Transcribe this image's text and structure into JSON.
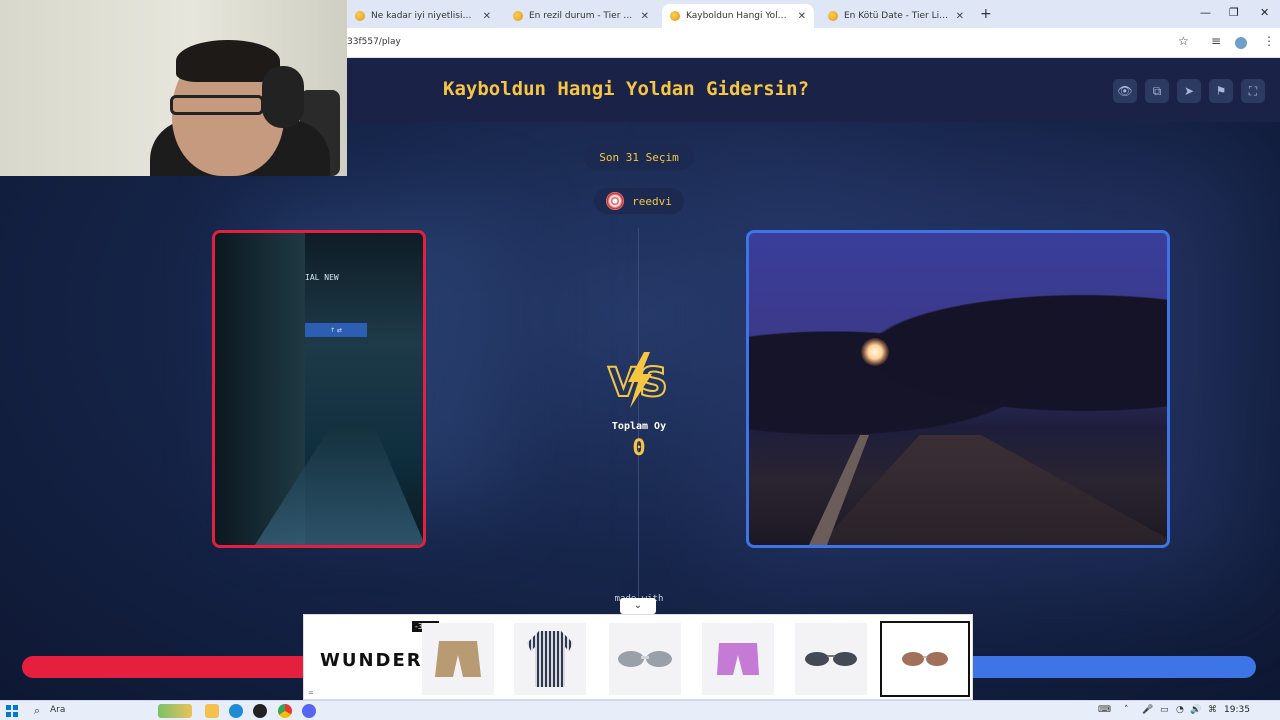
{
  "browser": {
    "tabs": [
      {
        "title": "Ne kadar iyi niyetlisin? - Tier Li…",
        "active": false
      },
      {
        "title": "En rezil durum - Tier List | Kör S…",
        "active": false
      },
      {
        "title": "Kayboldun Hangi Yoldan Gider…",
        "active": true
      },
      {
        "title": "En Kötü Date - Tier List | Kör S…",
        "active": false
      }
    ],
    "new_tab": "+",
    "url": "33f557/play",
    "window_controls": {
      "minimize": "—",
      "restore": "❐",
      "close": "✕"
    }
  },
  "game": {
    "title": "Kayboldun Hangi Yoldan Gidersin?",
    "recent_picks": "Son 31 Seçim",
    "user": "reedvi",
    "vs_text": "VS",
    "vote_label": "Toplam Oy",
    "vote_count": "0",
    "made_with": "made with",
    "left_sign": "IAL NEW",
    "left_vote_fraction": 0.5,
    "right_vote_fraction": 0.5,
    "colors": {
      "accent": "#f6c643",
      "left": "#e4203e",
      "right": "#3d74e6",
      "header": "#1a2347"
    }
  },
  "header_buttons": [
    "eye-icon",
    "share-icon",
    "send-icon",
    "flag-icon",
    "fullscreen-icon"
  ],
  "ad": {
    "brand": "WUNDER",
    "discount": "-30%",
    "products": [
      "shorts",
      "striped-shirt",
      "white-sunglasses",
      "purple-shorts",
      "dark-sunglasses",
      "brown-sunglasses"
    ]
  },
  "taskbar": {
    "search": "Ara",
    "time": "19:35"
  }
}
